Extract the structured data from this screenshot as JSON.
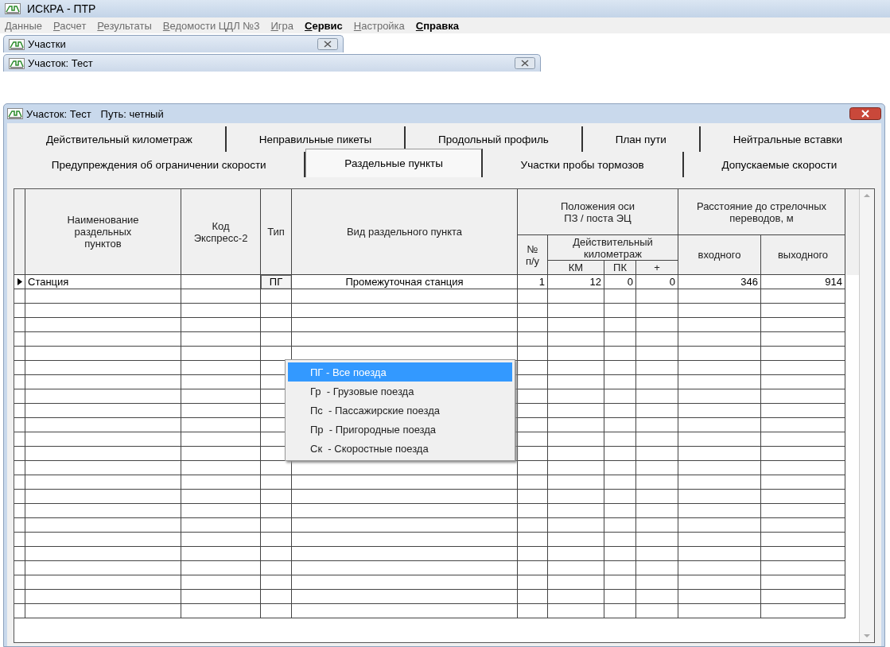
{
  "app": {
    "title": "ИСКРА - ПТР"
  },
  "menu": [
    {
      "label": "Данные",
      "disabled": true
    },
    {
      "label": "Расчет",
      "disabled": true
    },
    {
      "label": "Результаты",
      "disabled": true
    },
    {
      "label": "Ведомости ЦДЛ №3",
      "disabled": true
    },
    {
      "label": "Игра",
      "disabled": true
    },
    {
      "label": "Сервис",
      "disabled": false
    },
    {
      "label": "Настройка",
      "disabled": true
    },
    {
      "label": "Справка",
      "disabled": false
    }
  ],
  "minimized_windows": [
    {
      "title": "Участки"
    },
    {
      "title": "Участок: Тест"
    }
  ],
  "window": {
    "title": "Участок: Тест",
    "subtitle": "Путь: четный"
  },
  "tab_rows": [
    [
      {
        "label": "Действительный километраж",
        "selected": false
      },
      {
        "label": "Неправильные пикеты",
        "selected": false
      },
      {
        "label": "Продольный профиль",
        "selected": false
      },
      {
        "label": "План пути",
        "selected": false
      },
      {
        "label": "Нейтральные вставки",
        "selected": false
      }
    ],
    [
      {
        "label": "Предупреждения об ограничении скорости",
        "selected": false
      },
      {
        "label": "Раздельные пункты",
        "selected": true
      },
      {
        "label": "Участки пробы тормозов",
        "selected": false
      },
      {
        "label": "Допускаемые скорости",
        "selected": false
      }
    ]
  ],
  "table": {
    "headers": [
      {
        "label": "Наименование\nраздельных\nпунктов"
      },
      {
        "label": "Код\nЭкспресс-2"
      },
      {
        "label": "Тип"
      },
      {
        "label": "Вид раздельного пункта"
      },
      {
        "label": "Положения оси\nПЗ / поста ЭЦ"
      },
      {
        "label": "Расстояние до стрелочных\nпереводов, м"
      },
      {
        "label": "№\nп/у"
      },
      {
        "label": "Действительный\nкилометраж"
      },
      {
        "label": "входного"
      },
      {
        "label": "выходного"
      },
      {
        "label": "КМ"
      },
      {
        "label": "ПК"
      },
      {
        "label": "+"
      }
    ],
    "rows": [
      {
        "current": true,
        "cells": [
          "Станция",
          "",
          "ПГ",
          "Промежуточная станция",
          "1",
          "12",
          "0",
          "0",
          "346",
          "914"
        ]
      }
    ]
  },
  "dropdown": {
    "items": [
      {
        "label": "ПГ - Все поезда",
        "selected": true
      },
      {
        "label": "Гр  - Грузовые поезда",
        "selected": false
      },
      {
        "label": "Пс  - Пассажирские поезда",
        "selected": false
      },
      {
        "label": "Пр  - Пригородные поезда",
        "selected": false
      },
      {
        "label": "Ск  - Скоростные поезда",
        "selected": false
      }
    ]
  }
}
